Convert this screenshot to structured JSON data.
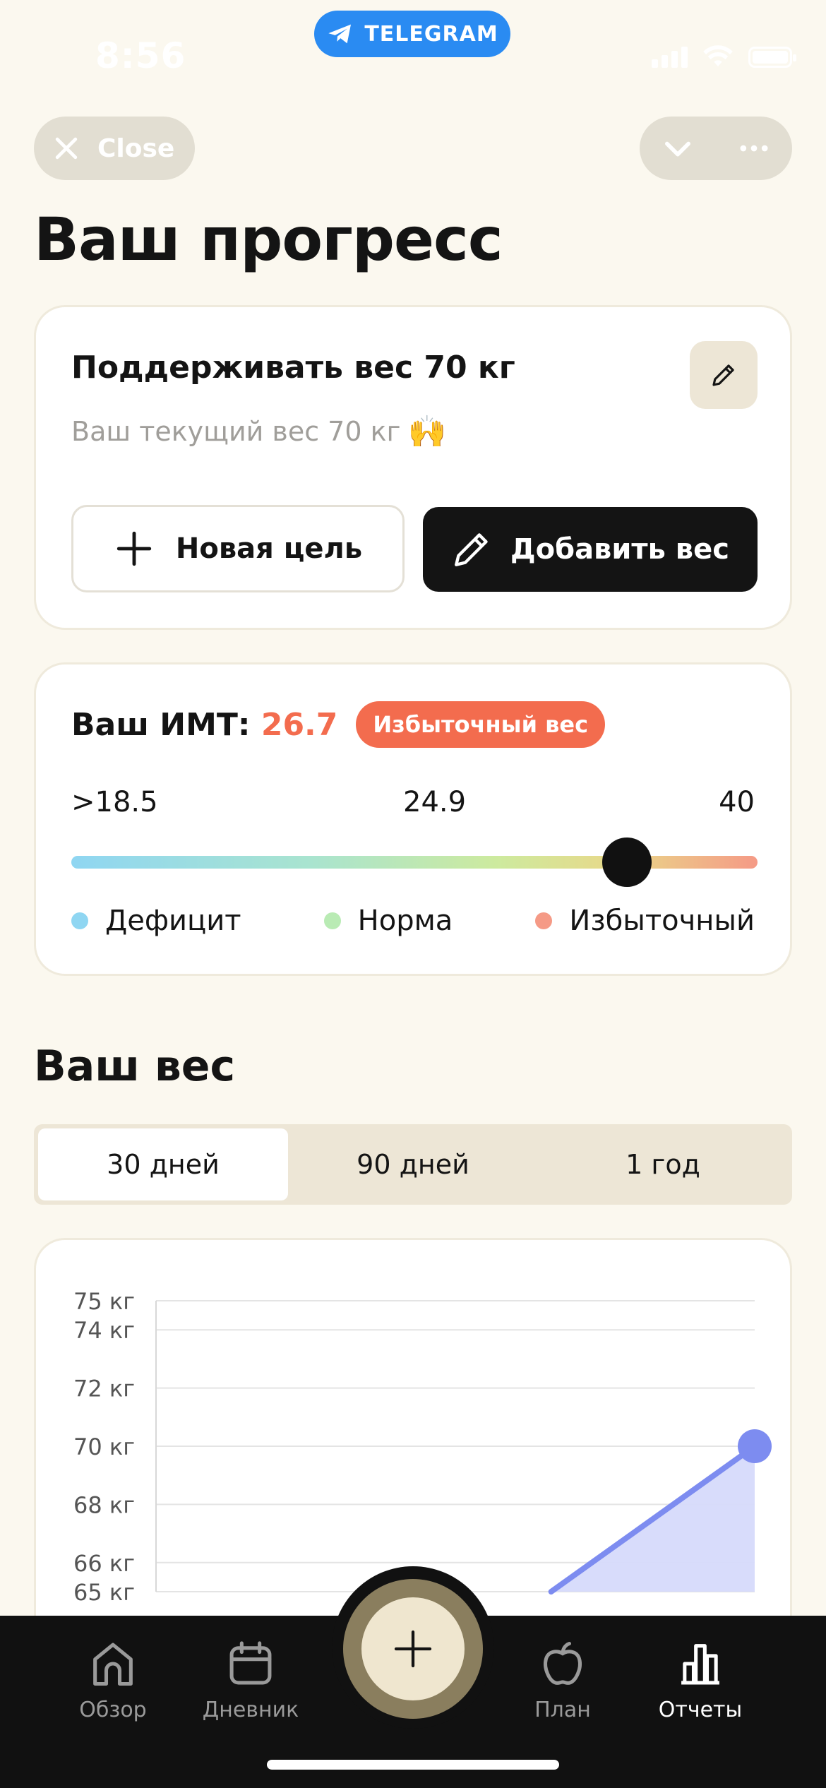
{
  "status_bar": {
    "time": "8:56",
    "app_pill": "TELEGRAM"
  },
  "header": {
    "close_label": "Close"
  },
  "page": {
    "title": "Ваш прогресс"
  },
  "goal": {
    "title": "Поддерживать вес 70 кг",
    "subtitle": "Ваш текущий вес 70 кг",
    "emoji": "🙌",
    "new_goal_label": "Новая цель",
    "add_weight_label": "Добавить вес"
  },
  "bmi": {
    "label": "Ваш ИМТ:",
    "value": "26.7",
    "badge": "Избыточный вес",
    "scale_min": ">18.5",
    "scale_mid": "24.9",
    "scale_max": "40",
    "marker_fraction": 0.81,
    "legend": [
      {
        "label": "Дефицит",
        "color": "#8FD6F2"
      },
      {
        "label": "Норма",
        "color": "#B9EBB4"
      },
      {
        "label": "Избыточный",
        "color": "#F59A86"
      }
    ],
    "badge_color": "#F36C4E"
  },
  "weight": {
    "title": "Ваш вес",
    "tabs": [
      {
        "label": "30 дней",
        "active": true
      },
      {
        "label": "90 дней",
        "active": false
      },
      {
        "label": "1 год",
        "active": false
      }
    ]
  },
  "chart_data": {
    "type": "area",
    "yticks": [
      {
        "value": 75,
        "label": "75 кг"
      },
      {
        "value": 74,
        "label": "74 кг"
      },
      {
        "value": 72,
        "label": "72 кг"
      },
      {
        "value": 70,
        "label": "70 кг"
      },
      {
        "value": 68,
        "label": "68 кг"
      },
      {
        "value": 66,
        "label": "66 кг"
      },
      {
        "value": 65,
        "label": "65 кг"
      }
    ],
    "ylim": [
      65,
      75
    ],
    "xlim": [
      0,
      1
    ],
    "series": [
      {
        "x": [
          0.66,
          1.0
        ],
        "y": [
          65,
          70
        ]
      }
    ],
    "color": "#7D8CF0",
    "fill_color": "#D6DAFB",
    "grid": true
  },
  "nav": {
    "items": [
      {
        "label": "Обзор",
        "icon": "home-icon",
        "active": false
      },
      {
        "label": "Дневник",
        "icon": "calendar-icon",
        "active": false
      },
      {
        "label": "План",
        "icon": "apple-icon",
        "active": false
      },
      {
        "label": "Отчеты",
        "icon": "bar-chart-icon",
        "active": true
      }
    ]
  },
  "colors": {
    "accent": "#F36C4E",
    "background": "#FBF8EF",
    "dark": "#141414"
  }
}
